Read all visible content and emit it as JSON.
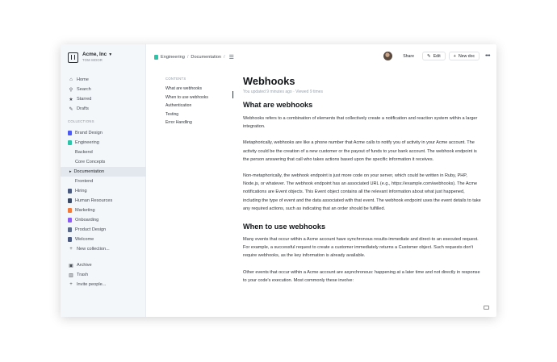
{
  "sidebar": {
    "team_name": "Acme, Inc",
    "team_user": "TOM MOOR",
    "primary": [
      {
        "label": "Home",
        "icon": "home-icon",
        "glyph": "⌂"
      },
      {
        "label": "Search",
        "icon": "search-icon",
        "glyph": "⚲"
      },
      {
        "label": "Starred",
        "icon": "star-icon",
        "glyph": "★"
      },
      {
        "label": "Drafts",
        "icon": "pencil-icon",
        "glyph": "✎"
      }
    ],
    "collections_label": "COLLECTIONS",
    "collections": [
      {
        "label": "Brand Design",
        "color": "#4e5bf2"
      },
      {
        "label": "Engineering",
        "color": "#2bc4a8"
      },
      {
        "label": "Backend",
        "sub": true
      },
      {
        "label": "Core Concepts",
        "sub": true
      },
      {
        "label": "Documentation",
        "sub": true,
        "active": true
      },
      {
        "label": "Frontend",
        "sub": true
      },
      {
        "label": "Hiring",
        "color": "#4a5a80"
      },
      {
        "label": "Human Resources",
        "color": "#3a4a66"
      },
      {
        "label": "Marketing",
        "color": "#f27a3a"
      },
      {
        "label": "Onboarding",
        "color": "#8a5cf2"
      },
      {
        "label": "Product Design",
        "color": "#5a6a8a"
      },
      {
        "label": "Welcome",
        "color": "#4a5a80"
      }
    ],
    "new_collection": "New collection...",
    "footer": [
      {
        "label": "Archive",
        "icon": "archive-icon",
        "glyph": "▣"
      },
      {
        "label": "Trash",
        "icon": "trash-icon",
        "glyph": "▥"
      },
      {
        "label": "Invite people...",
        "icon": "plus-icon",
        "glyph": "+"
      }
    ]
  },
  "topbar": {
    "crumb_collection": "Engineering",
    "crumb_doc": "Documentation",
    "crumb_sep": "/",
    "share": "Share",
    "edit": "Edit",
    "new_doc": "New doc",
    "more": "•••"
  },
  "toc": {
    "label": "CONTENTS",
    "items": [
      "What are webhooks",
      "When to use webhooks",
      "Authentication",
      "Testing",
      "Error Handling"
    ]
  },
  "doc": {
    "title": "Webhooks",
    "meta": "You updated 9 minutes ago · Viewed 9 times",
    "h2_1": "What are webhooks",
    "p1": "Webhooks refers to a combination of elements that collectively create a notification and reaction system within a larger integration.",
    "p2": "Metaphorically, webhooks are like a phone number that Acme calls to notify you of activity in your Acme account. The activity could be the creation of a new customer or the payout of funds to your bank account. The webhook endpoint is the person answering that call who takes actions based upon the specific information it receives.",
    "p3": "Non-metaphorically, the webhook endpoint is just more code on your server, which could be written in Ruby, PHP, Node.js, or whatever. The webhook endpoint has an associated URL (e.g., https://example.com/webhooks). The Acme notifications are Event objects. This Event object contains all the relevant information about what just happened, including the type of event and the data associated with that event. The webhook endpoint uses the event details to take any required actions, such as indicating that an order should be fulfilled.",
    "h2_2": "When to use webhooks",
    "p4": "Many events that occur within a Acme account have synchronous results-immediate and direct-to an executed request. For example, a successful request to create a customer immediately returns a Customer object. Such requests don't require webhooks, as the key information is already available.",
    "p5": "Other events that occur within a Acme account are asynchronous: happening at a later time and not directly in response to your code's execution. Most commonly these involve:"
  }
}
